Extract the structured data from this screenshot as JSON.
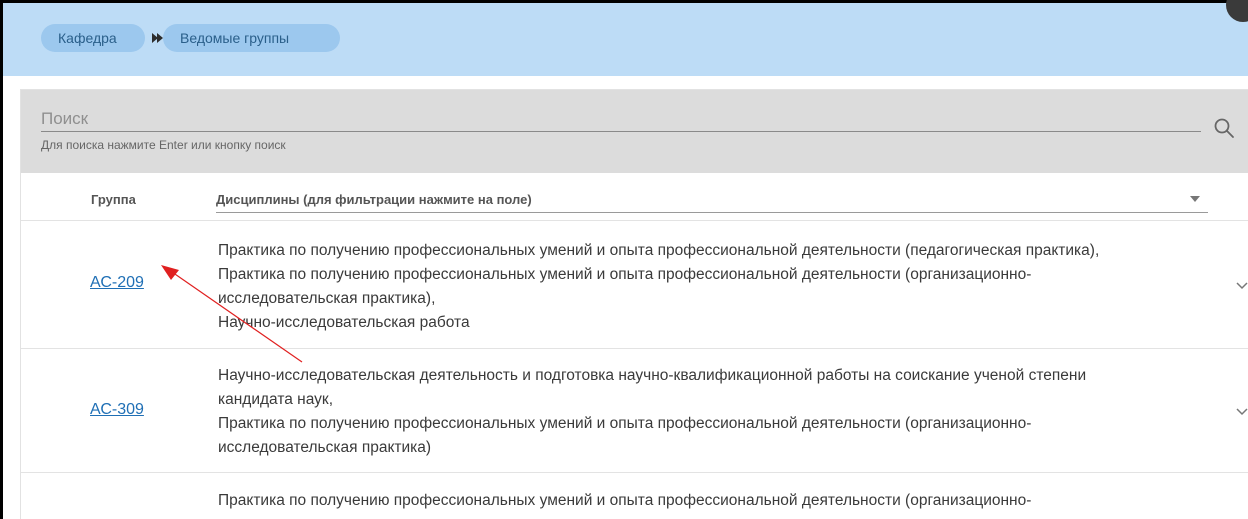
{
  "breadcrumb": {
    "items": [
      {
        "label": "Кафедра"
      },
      {
        "label": "Ведомые группы"
      }
    ]
  },
  "search": {
    "placeholder": "Поиск",
    "value": "",
    "hint": "Для поиска нажмите Enter или кнопку поиск"
  },
  "table": {
    "col_group": "Группа",
    "col_disciplines": "Дисциплины (для фильтрации нажмите на поле)",
    "rows": [
      {
        "group": "АС-209",
        "lines": [
          "Практика по получению профессиональных умений и опыта профессиональной деятельности (педагогическая практика),",
          "Практика по получению профессиональных умений и опыта профессиональной деятельности (организационно-",
          "исследовательская практика),",
          "Научно-исследовательская работа"
        ]
      },
      {
        "group": "АС-309",
        "lines": [
          "Научно-исследовательская деятельность и подготовка научно-квалификационной работы на соискание ученой степени",
          "кандидата наук,",
          "Практика по получению профессиональных умений и опыта профессиональной деятельности (организационно-",
          "исследовательская практика)"
        ]
      },
      {
        "group": "",
        "lines": [
          "Практика по получению профессиональных умений и опыта профессиональной деятельности (организационно-"
        ]
      }
    ]
  },
  "icons": {
    "search": "search-icon",
    "dropdown": "triangle-down-icon",
    "expand": "chevron-down-icon",
    "breadcrumb_separator": "double-chevron-right-icon"
  },
  "colors": {
    "topbar": "#bddcf6",
    "crumb": "#9cc8ee",
    "link": "#1f6fb5",
    "annotation_arrow": "#e02020"
  }
}
